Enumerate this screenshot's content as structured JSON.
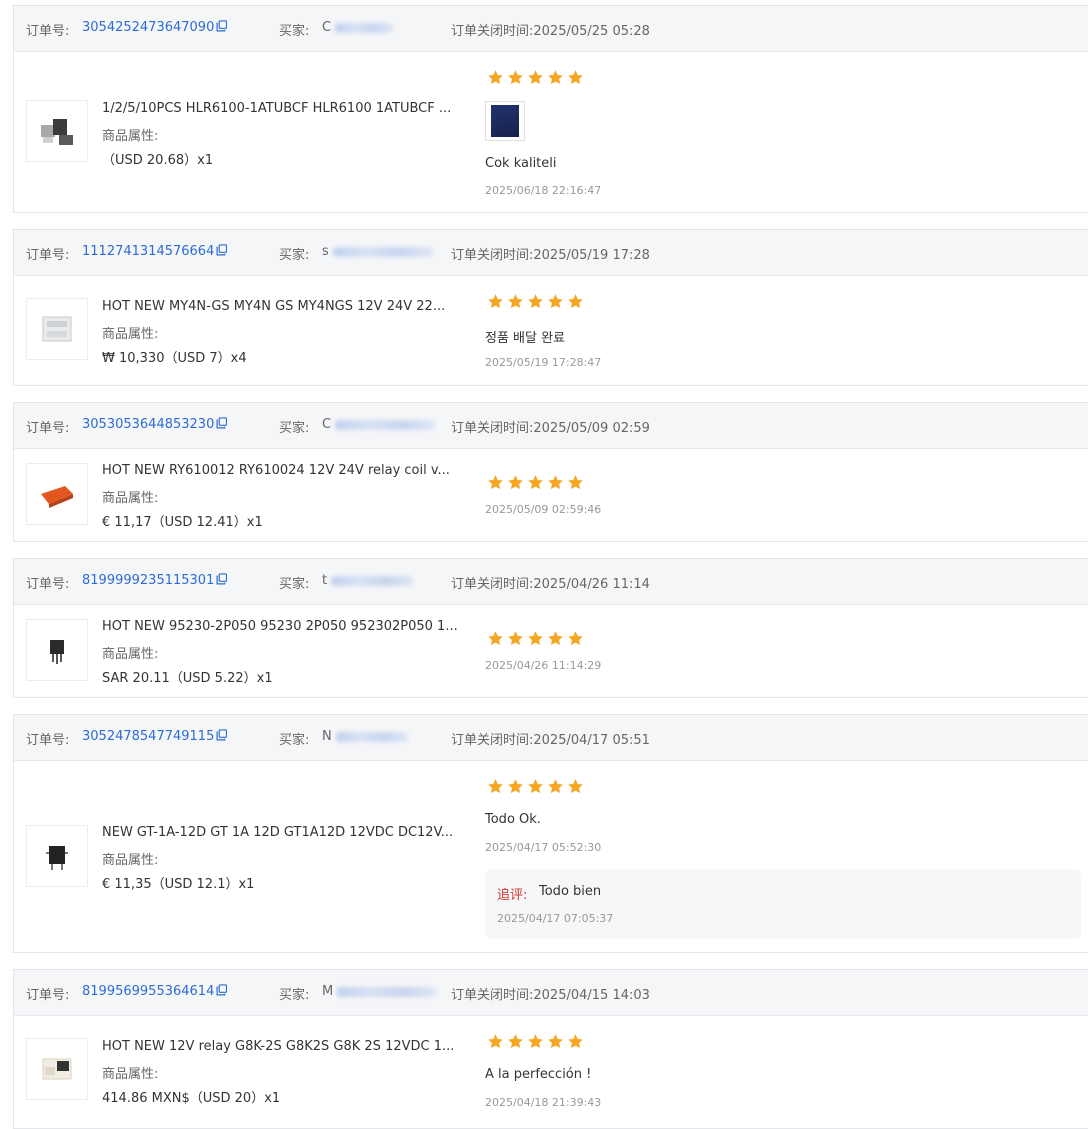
{
  "labels": {
    "order_no": "订单号:",
    "buyer": "买家:",
    "attr": "商品属性:",
    "followup": "追评:"
  },
  "colors": {
    "link": "#2d6bd6",
    "star": "#f5a623",
    "followup_label": "#d0342c",
    "header_bg": "#f5f6f8"
  },
  "icons": {
    "copy": "copy-icon",
    "star": "star-icon"
  },
  "orders": [
    {
      "order_no": "3054252473647090",
      "buyer_initial": "C",
      "close_time": "订单关闭时间:2025/05/25 05:28",
      "title": "1/2/5/10PCS HLR6100-1ATUBCF HLR6100 1ATUBCF ...",
      "price": "（USD  20.68）x1",
      "rating": 5,
      "comment": "Cok kaliteli",
      "review_time": "2025/06/18 22:16:47"
    },
    {
      "order_no": "1112741314576664",
      "buyer_initial": "s",
      "close_time": "订单关闭时间:2025/05/19 17:28",
      "title": "HOT NEW MY4N-GS MY4N GS MY4NGS 12V 24V 22...",
      "price": "₩ 10,330（USD  7）x4",
      "rating": 5,
      "comment": "정품 배달 완료",
      "review_time": "2025/05/19 17:28:47"
    },
    {
      "order_no": "3053053644853230",
      "buyer_initial": "C",
      "close_time": "订单关闭时间:2025/05/09 02:59",
      "title": "HOT NEW RY610012 RY610024 12V 24V relay coil v...",
      "price": "€ 11,17（USD  12.41）x1",
      "rating": 5,
      "comment": "",
      "review_time": "2025/05/09 02:59:46"
    },
    {
      "order_no": "8199999235115301",
      "buyer_initial": "t",
      "close_time": "订单关闭时间:2025/04/26 11:14",
      "title": "HOT NEW 95230-2P050 95230 2P050 952302P050 1...",
      "price": "SAR 20.11（USD  5.22）x1",
      "rating": 5,
      "comment": "",
      "review_time": "2025/04/26 11:14:29"
    },
    {
      "order_no": "3052478547749115",
      "buyer_initial": "N",
      "close_time": "订单关闭时间:2025/04/17 05:51",
      "title": "NEW GT-1A-12D GT 1A 12D GT1A12D 12VDC DC12V...",
      "price": "€ 11,35（USD  12.1）x1",
      "rating": 5,
      "comment": "Todo Ok.",
      "review_time": "2025/04/17 05:52:30",
      "followup_text": "Todo bien",
      "followup_time": "2025/04/17 07:05:37"
    },
    {
      "order_no": "8199569955364614",
      "buyer_initial": "M",
      "close_time": "订单关闭时间:2025/04/15 14:03",
      "title": "HOT NEW 12V relay G8K-2S G8K2S G8K 2S 12VDC 1...",
      "price": "414.86 MXN$（USD  20）x1",
      "rating": 5,
      "comment": "A la perfección !",
      "review_time": "2025/04/18 21:39:43"
    }
  ]
}
